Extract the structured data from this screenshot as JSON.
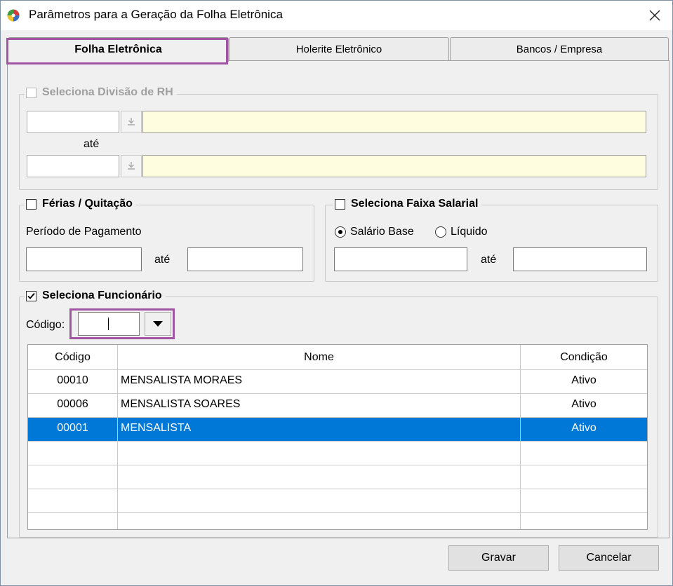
{
  "window": {
    "title": "Parâmetros para a Geração da Folha Eletrônica",
    "icon": "app-globe-icon",
    "close_symbol": "✕"
  },
  "tabs": [
    {
      "label": "Folha Eletrônica",
      "active": true
    },
    {
      "label": "Holerite Eletrônico",
      "active": false
    },
    {
      "label": "Bancos / Empresa",
      "active": false
    }
  ],
  "divisao": {
    "label": "Seleciona Divisão de RH",
    "checked": false,
    "enabled": false,
    "from_code": "",
    "from_desc": "",
    "ate_label": "até",
    "to_code": "",
    "to_desc": ""
  },
  "ferias": {
    "label": "Férias / Quitação",
    "checked": false,
    "periodo_label": "Período de Pagamento",
    "from": "",
    "ate_label": "até",
    "to": ""
  },
  "faixa": {
    "label": "Seleciona Faixa Salarial",
    "checked": false,
    "radio_salario": "Salário Base",
    "radio_liquido": "Líquido",
    "selected": "Salário Base",
    "from": "",
    "ate_label": "até",
    "to": ""
  },
  "funcionario": {
    "label": "Seleciona Funcionário",
    "checked": true,
    "codigo_label": "Código:",
    "codigo_value": "",
    "table": {
      "columns": [
        "Código",
        "Nome",
        "Condição"
      ],
      "rows": [
        {
          "codigo": "00010",
          "nome": "MENSALISTA MORAES",
          "condicao": "Ativo",
          "selected": false
        },
        {
          "codigo": "00006",
          "nome": "MENSALISTA SOARES",
          "condicao": "Ativo",
          "selected": false
        },
        {
          "codigo": "00001",
          "nome": "MENSALISTA",
          "condicao": "Ativo",
          "selected": true
        }
      ]
    }
  },
  "buttons": {
    "gravar": "Gravar",
    "cancelar": "Cancelar"
  },
  "colors": {
    "highlight": "#a054a2",
    "selection": "#0078d7",
    "lookup_fill": "#fffde0"
  }
}
